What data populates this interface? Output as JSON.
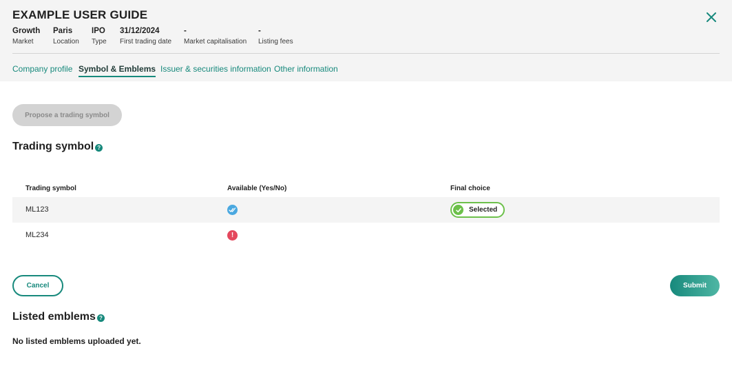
{
  "header": {
    "title": "EXAMPLE USER GUIDE",
    "meta": [
      {
        "value": "Growth",
        "key": "Market"
      },
      {
        "value": "Paris",
        "key": "Location"
      },
      {
        "value": "IPO",
        "key": "Type"
      },
      {
        "value": "31/12/2024",
        "key": "First trading date"
      },
      {
        "value": "-",
        "key": "Market capitalisation"
      },
      {
        "value": "-",
        "key": "Listing fees"
      }
    ]
  },
  "tabs": [
    {
      "label": "Company profile",
      "active": false
    },
    {
      "label": "Symbol & Emblems",
      "active": true
    },
    {
      "label": "Issuer & securities information",
      "active": false
    },
    {
      "label": "Other information",
      "active": false
    }
  ],
  "propose_button": {
    "label": "Propose a trading symbol"
  },
  "trading_symbol": {
    "title": "Trading symbol",
    "columns": [
      "Trading symbol",
      "Available (Yes/No)",
      "Final choice"
    ],
    "rows": [
      {
        "symbol": "ML123",
        "available": "yes",
        "final_choice": "Selected"
      },
      {
        "symbol": "ML234",
        "available": "no",
        "final_choice": ""
      }
    ]
  },
  "actions": {
    "cancel": "Cancel",
    "submit": "Submit"
  },
  "listed_emblems": {
    "title": "Listed emblems",
    "empty_text": "No listed emblems uploaded yet."
  },
  "colors": {
    "accent": "#17897c",
    "header_bg": "#f4f4f4",
    "success": "#6cc04a",
    "available": "#4aa8e0",
    "error": "#e4485d",
    "disabled": "#d3d3d3"
  },
  "icons": {
    "close": "close-icon",
    "help": "help-icon",
    "available": "double-check-icon",
    "unavailable": "exclamation-icon",
    "selected": "check-circle-icon"
  }
}
